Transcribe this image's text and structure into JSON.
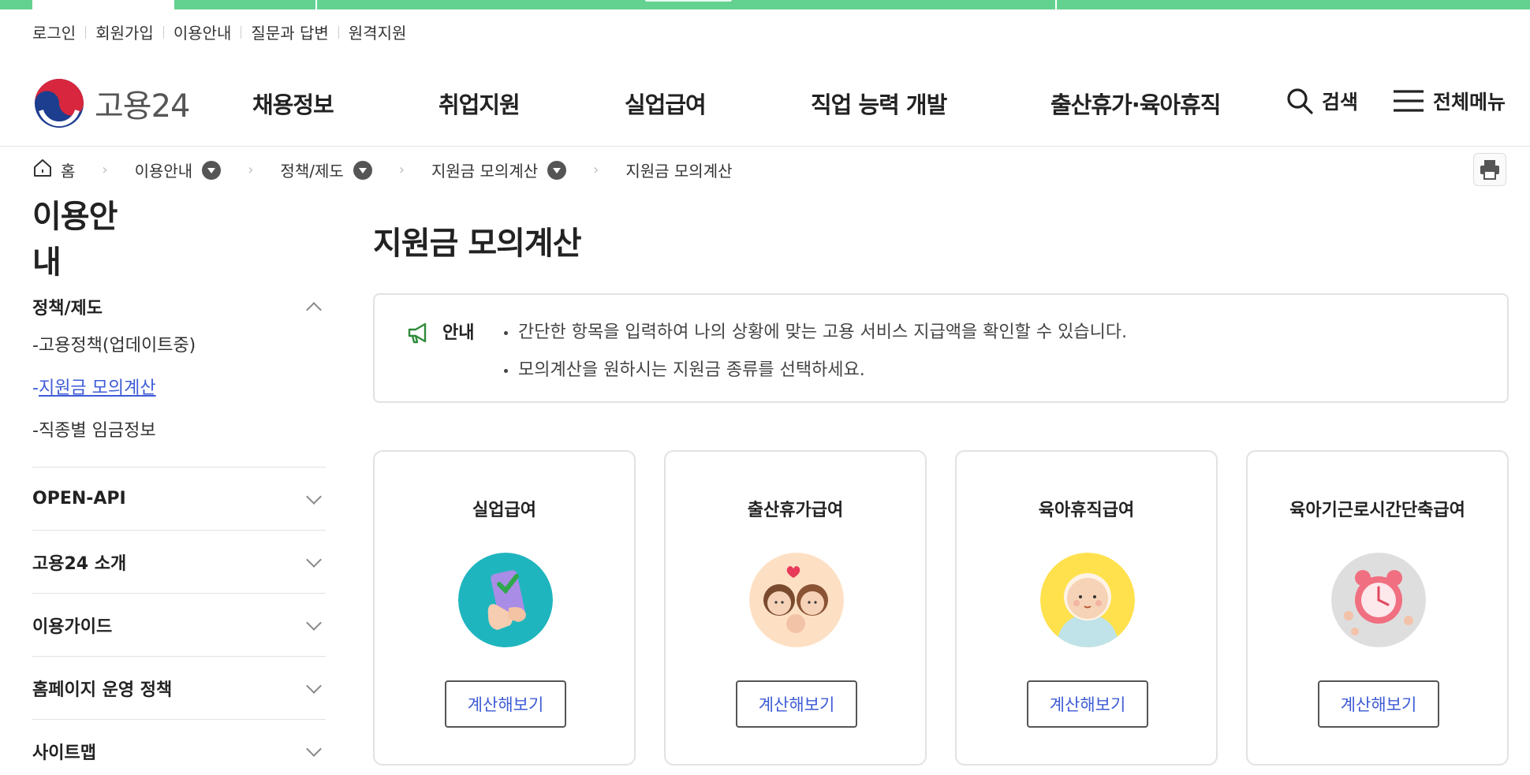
{
  "util_links": [
    "로그인",
    "회원가입",
    "이용안내",
    "질문과 답변",
    "원격지원"
  ],
  "logo": {
    "text": "고용24"
  },
  "gnb": {
    "menu": [
      "채용정보",
      "취업지원",
      "실업급여",
      "직업 능력 개발",
      "출산휴가·육아휴직"
    ],
    "search_label": "검색",
    "all_menu_label": "전체메뉴"
  },
  "breadcrumb": {
    "home": "홈",
    "items": [
      "이용안내",
      "정책/제도",
      "지원금 모의계산"
    ],
    "current": "지원금 모의계산"
  },
  "sidebar": {
    "title_line1": "이용안",
    "title_line2": "내",
    "open_group": "정책/제도",
    "sub_items": [
      {
        "label": "-고용정책(업데이트중)",
        "active": false
      },
      {
        "label": "지원금 모의계산",
        "active": true
      },
      {
        "label": "-직종별 임금정보",
        "active": false
      }
    ],
    "active_dash": "-",
    "groups": [
      "OPEN-API",
      "고용24 소개",
      "이용가이드",
      "홈페이지 운영 정책",
      "사이트맵"
    ]
  },
  "page_title": "지원금 모의계산",
  "notice": {
    "label": "안내",
    "lines": [
      "간단한 항목을 입력하여 나의 상황에 맞는 고용 서비스 지급액을 확인할 수 있습니다.",
      "모의계산을 원하시는 지원금 종류를 선택하세요."
    ]
  },
  "cards": [
    {
      "title": "실업급여",
      "button": "계산해보기",
      "icon": "phone-check-illustration"
    },
    {
      "title": "출산휴가급여",
      "button": "계산해보기",
      "icon": "family-illustration"
    },
    {
      "title": "육아휴직급여",
      "button": "계산해보기",
      "icon": "baby-illustration"
    },
    {
      "title": "육아기근로시간단축급여",
      "button": "계산해보기",
      "icon": "alarm-clock-illustration"
    }
  ],
  "colors": {
    "brand_green": "#63d190",
    "link_blue": "#3d5bd6"
  }
}
